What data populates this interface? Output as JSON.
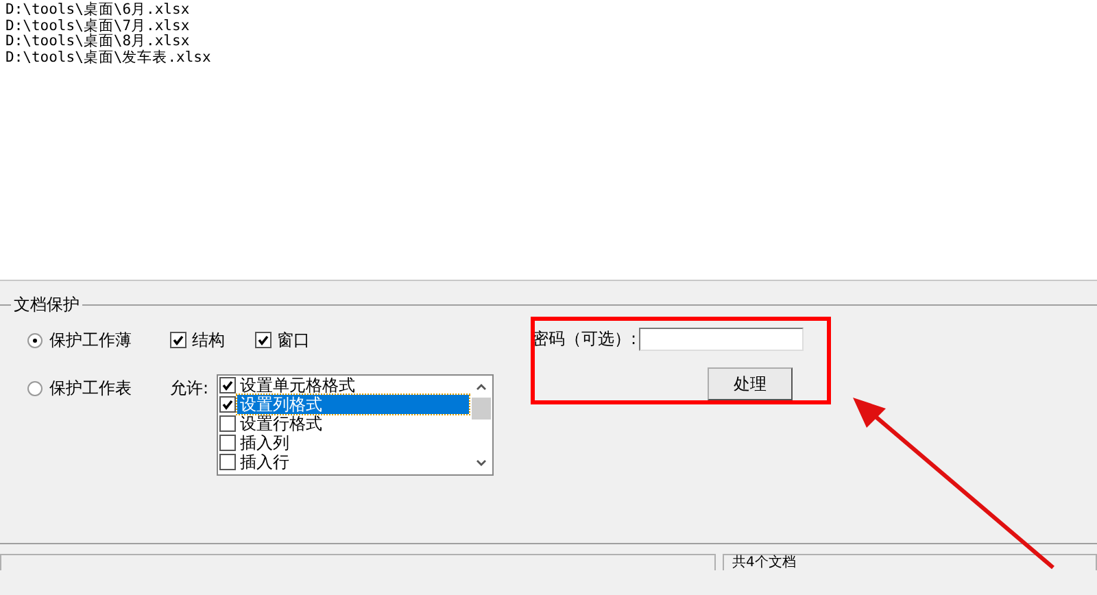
{
  "file_list": [
    "D:\\tools\\桌面\\6月.xlsx",
    "D:\\tools\\桌面\\7月.xlsx",
    "D:\\tools\\桌面\\8月.xlsx",
    "D:\\tools\\桌面\\发车表.xlsx"
  ],
  "group_title": "文档保护",
  "workbook": {
    "label": "保护工作薄",
    "selected": true,
    "options": [
      {
        "label": "结构",
        "checked": true
      },
      {
        "label": "窗口",
        "checked": true
      }
    ]
  },
  "worksheet": {
    "label": "保护工作表",
    "selected": false,
    "allow_label": "允许:",
    "items": [
      {
        "label": "设置单元格格式",
        "checked": true,
        "selected": false
      },
      {
        "label": "设置列格式",
        "checked": true,
        "selected": true
      },
      {
        "label": "设置行格式",
        "checked": false,
        "selected": false
      },
      {
        "label": "插入列",
        "checked": false,
        "selected": false
      },
      {
        "label": "插入行",
        "checked": false,
        "selected": false
      }
    ]
  },
  "password": {
    "label": "密码（可选）:"
  },
  "process_button": "处理",
  "status_bar": {
    "count": "共4个文档"
  }
}
